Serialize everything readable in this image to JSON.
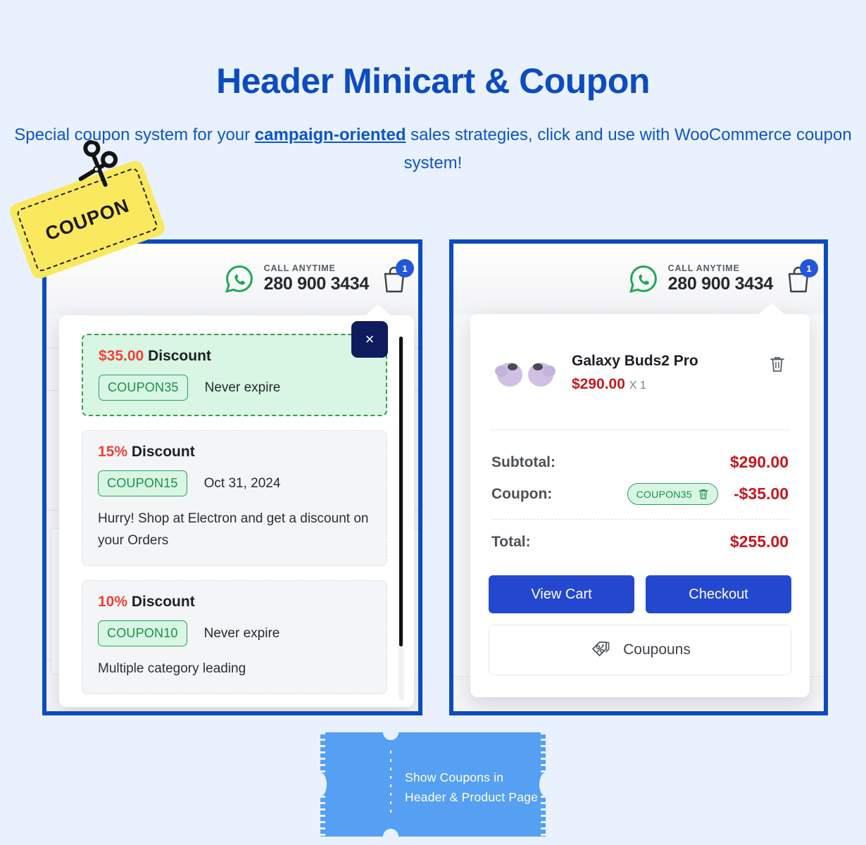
{
  "page": {
    "title": "Header Minicart & Coupon",
    "subtitle_part1": "Special coupon system for your ",
    "subtitle_emphasis": "campaign-oriented",
    "subtitle_part2": " sales strategies, click and use with WooCommerce coupon system!",
    "background_color": "#e8f1fd",
    "brand_blue": "#0d4bbf"
  },
  "coupon_sticker": {
    "label": "COUPON",
    "icon": "scissors-icon",
    "color": "#fae85f"
  },
  "site_header": {
    "whatsapp_icon": "whatsapp-icon",
    "call_label": "CALL ANYTIME",
    "phone": "280 900 3434",
    "cart_icon": "shopping-bag-icon",
    "cart_count": "1",
    "compare_icon": "compare-icon",
    "badge_color": "#2157d8"
  },
  "coupon_dropdown": {
    "close_label": "×",
    "coupons": [
      {
        "amount": "$35.00",
        "amount_suffix": "Discount",
        "code": "COUPON35",
        "expiry": "Never expire",
        "description": "",
        "active": true
      },
      {
        "amount": "15%",
        "amount_suffix": "Discount",
        "code": "COUPON15",
        "expiry": "Oct 31, 2024",
        "description": "Hurry! Shop at Electron and get a discount on your Orders",
        "active": false
      },
      {
        "amount": "10%",
        "amount_suffix": "Discount",
        "code": "COUPON10",
        "expiry": "Never expire",
        "description": "Multiple category leading",
        "active": false
      }
    ],
    "accent_red": "#f04038",
    "accent_green": "#18914c",
    "active_bg": "#d8f6e3"
  },
  "minicart_dropdown": {
    "item": {
      "thumb_icon": "earbuds-product-image",
      "name": "Galaxy Buds2 Pro",
      "price": "$290.00",
      "quantity": "X 1",
      "remove_icon": "trash-icon"
    },
    "totals": [
      {
        "label": "Subtotal:",
        "value": "$290.00"
      },
      {
        "label": "Coupon:",
        "value": "-$35.00",
        "chip": "COUPON35",
        "chip_icon": "trash-icon"
      },
      {
        "label": "Total:",
        "value": "$255.00"
      }
    ],
    "view_cart_label": "View Cart",
    "checkout_label": "Checkout",
    "coupons_label": "Coupouns",
    "coupons_icon": "percent-tag-icon",
    "button_color": "#2348cf",
    "price_color": "#c4181e"
  },
  "footer_ticket": {
    "line1": "Show Coupons in",
    "line2": "Header & Product Page",
    "color": "#55a0f2"
  }
}
